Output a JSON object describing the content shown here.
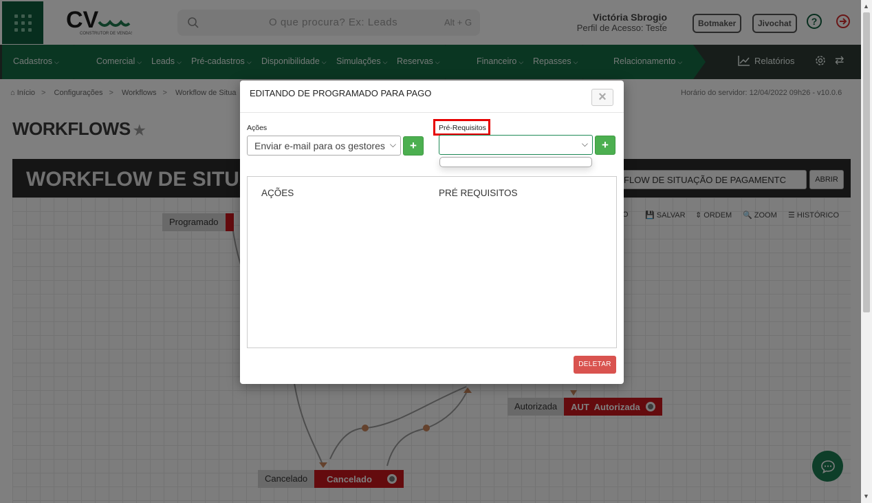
{
  "header": {
    "search_placeholder": "O que procura? Ex: Leads",
    "search_shortcut": "Alt + G",
    "user_name": "Victória Sbrogio",
    "user_role": "Perfil de Acesso: Teste",
    "botmaker_label": "Botmaker",
    "jivochat_label": "Jivochat",
    "brand_color": "#0f5c3c"
  },
  "nav": {
    "items": [
      {
        "label": "Cadastros"
      },
      {
        "label": "Comercial"
      },
      {
        "label": "Leads"
      },
      {
        "label": "Pré-cadastros"
      },
      {
        "label": "Disponibilidade"
      },
      {
        "label": "Simulações"
      },
      {
        "label": "Reservas"
      },
      {
        "label": "Financeiro"
      },
      {
        "label": "Repasses"
      },
      {
        "label": "Relacionamento"
      }
    ],
    "reports_label": "Relatórios"
  },
  "breadcrumb": {
    "items": [
      "Início",
      "Configurações",
      "Workflows",
      "Workflow de Situa"
    ]
  },
  "server_time": "Horário do servidor: 12/04/2022 09h26 - v10.0.6",
  "page_title": "WORKFLOWS",
  "workflow": {
    "title": "WORKFLOW DE SITUA",
    "select_value": "RKFLOW DE SITUAÇÃO DE PAGAMENTC",
    "open_label": "ABRIR",
    "toolbar": [
      "O",
      "SALVAR",
      "ORDEM",
      "ZOOM",
      "HISTÓRICO"
    ],
    "nodes": [
      {
        "label": "Programado",
        "box": ""
      },
      {
        "label": "Autorizada",
        "box": "AUT  Autorizada"
      },
      {
        "label": "Cancelado",
        "box": "Cancelado"
      }
    ]
  },
  "modal": {
    "title": "EDITANDO DE PROGRAMADO PARA PAGO",
    "close_symbol": "×",
    "actions_label": "Ações",
    "actions_value": "Enviar e-mail para os gestores",
    "prereq_label": "Pré-Requisitos",
    "prereq_value": "",
    "add_symbol": "+",
    "col_actions": "AÇÕES",
    "col_prereq": "PRÉ REQUISITOS",
    "delete_label": "DELETAR"
  },
  "icons": {
    "apps": "grid-icon",
    "search": "search-icon",
    "help": "help-icon",
    "logout": "logout-icon",
    "chat": "chat-icon"
  }
}
